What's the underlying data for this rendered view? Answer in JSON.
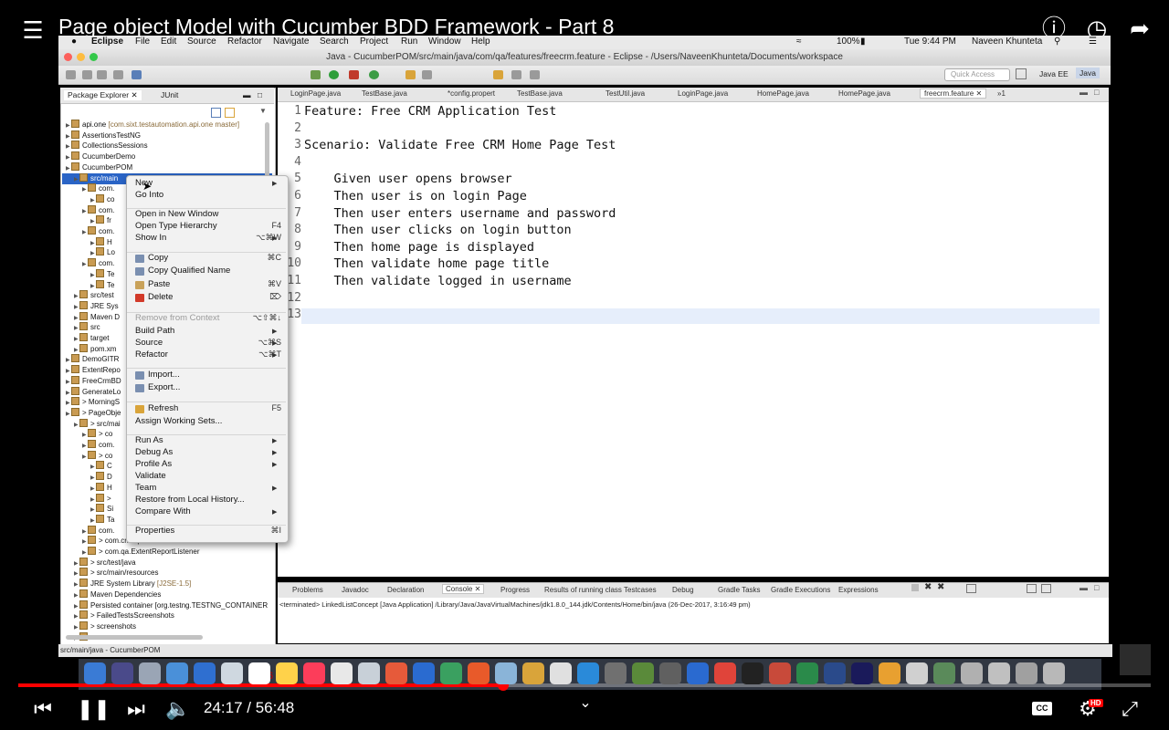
{
  "video": {
    "title": "Page object Model with Cucumber BDD Framework - Part 8",
    "time": "24:17 / 56:48",
    "progress_fraction": 0.428,
    "hd_badge": "HD"
  },
  "menubar": {
    "apple": "",
    "items": [
      "Eclipse",
      "File",
      "Edit",
      "Source",
      "Refactor",
      "Navigate",
      "Search",
      "Project",
      "Run",
      "Window",
      "Help"
    ],
    "battery": "100%",
    "clock": "Tue 9:44 PM",
    "user": "Naveen Khunteta"
  },
  "window": {
    "title": "Java - CucumberPOM/src/main/java/com/qa/features/freecrm.feature - Eclipse - /Users/NaveenKhunteta/Documents/workspace",
    "quick_access": "Quick Access",
    "perspectives": [
      "Java EE",
      "Java"
    ]
  },
  "left_panel": {
    "tabs": [
      "Package Explorer",
      "JUnit"
    ],
    "tree": [
      {
        "text": "api.one",
        "dim": " [com.sixt.testautomation.api.one master]"
      },
      {
        "text": "AssertionsTestNG",
        "dim": ""
      },
      {
        "text": "CollectionsSessions",
        "dim": ""
      },
      {
        "text": "CucumberDemo",
        "dim": ""
      },
      {
        "text": "CucumberPOM",
        "dim": ""
      },
      {
        "text": "src/main",
        "dim": ""
      },
      {
        "text": "com.",
        "dim": ""
      },
      {
        "text": "co",
        "dim": ""
      },
      {
        "text": "com.",
        "dim": ""
      },
      {
        "text": "fr",
        "dim": ""
      },
      {
        "text": "com.",
        "dim": ""
      },
      {
        "text": "H",
        "dim": ""
      },
      {
        "text": "Lo",
        "dim": ""
      },
      {
        "text": "com.",
        "dim": ""
      },
      {
        "text": "Te",
        "dim": ""
      },
      {
        "text": "Te",
        "dim": ""
      },
      {
        "text": "src/test",
        "dim": ""
      },
      {
        "text": "JRE Sys",
        "dim": ""
      },
      {
        "text": "Maven D",
        "dim": ""
      },
      {
        "text": "src",
        "dim": ""
      },
      {
        "text": "target",
        "dim": ""
      },
      {
        "text": "pom.xm",
        "dim": ""
      },
      {
        "text": "DemoGITR",
        "dim": ""
      },
      {
        "text": "ExtentRepo",
        "dim": ""
      },
      {
        "text": "FreeCrmBD",
        "dim": ""
      },
      {
        "text": "GenerateLo",
        "dim": ""
      },
      {
        "text": "> MorningS",
        "dim": ""
      },
      {
        "text": "> PageObje",
        "dim": ""
      },
      {
        "text": "> src/mai",
        "dim": ""
      },
      {
        "text": "> co",
        "dim": ""
      },
      {
        "text": "com.",
        "dim": ""
      },
      {
        "text": "> co",
        "dim": ""
      },
      {
        "text": "C",
        "dim": ""
      },
      {
        "text": "D",
        "dim": ""
      },
      {
        "text": "H",
        "dim": ""
      },
      {
        "text": ">",
        "dim": ""
      },
      {
        "text": "Si",
        "dim": ""
      },
      {
        "text": "Ta",
        "dim": ""
      },
      {
        "text": "com.",
        "dim": ""
      },
      {
        "text": "> com.crm.qa.util",
        "dim": ""
      },
      {
        "text": "> com.qa.ExtentReportListener",
        "dim": ""
      },
      {
        "text": "> src/test/java",
        "dim": ""
      },
      {
        "text": "> src/main/resources",
        "dim": ""
      },
      {
        "text": "JRE System Library",
        "dim": " [J2SE-1.5]"
      },
      {
        "text": "Maven Dependencies",
        "dim": ""
      },
      {
        "text": "Persisted container [org.testng.TESTNG_CONTAINER",
        "dim": ""
      },
      {
        "text": "> FailedTestsScreenshots",
        "dim": ""
      },
      {
        "text": "> screenshots",
        "dim": ""
      },
      {
        "text": "> src",
        "dim": ""
      }
    ]
  },
  "editor": {
    "tabs": [
      "LoginPage.java",
      "TestBase.java",
      "*config.propert",
      "TestBase.java",
      "TestUtil.java",
      "LoginPage.java",
      "HomePage.java",
      "HomePage.java",
      "freecrm.feature",
      "»1"
    ],
    "active_tab": "freecrm.feature",
    "lines": [
      {
        "n": "1",
        "text": "Feature: Free CRM Application Test"
      },
      {
        "n": "2",
        "text": ""
      },
      {
        "n": "3",
        "text": "Scenario: Validate Free CRM Home Page Test"
      },
      {
        "n": "4",
        "text": ""
      },
      {
        "n": "5",
        "text": "    Given user opens browser"
      },
      {
        "n": "6",
        "text": "    Then user is on login Page"
      },
      {
        "n": "7",
        "text": "    Then user enters username and password"
      },
      {
        "n": "8",
        "text": "    Then user clicks on login button"
      },
      {
        "n": "9",
        "text": "    Then home page is displayed"
      },
      {
        "n": "10",
        "text": "    Then validate home page title"
      },
      {
        "n": "11",
        "text": "    Then validate logged in username"
      },
      {
        "n": "12",
        "text": ""
      },
      {
        "n": "13",
        "text": ""
      }
    ]
  },
  "context_menu": {
    "items": [
      {
        "label": "New",
        "arrow": true
      },
      {
        "label": "Go Into"
      },
      {
        "label": "Open in New Window"
      },
      {
        "label": "Open Type Hierarchy",
        "shortcut": "F4"
      },
      {
        "label": "Show In",
        "shortcut": "⌥⌘W",
        "arrow": true
      },
      {
        "label": "Copy",
        "shortcut": "⌘C"
      },
      {
        "label": "Copy Qualified Name"
      },
      {
        "label": "Paste",
        "shortcut": "⌘V"
      },
      {
        "label": "Delete",
        "shortcut": "⌦"
      },
      {
        "label": "Remove from Context",
        "shortcut": "⌥⇧⌘↓",
        "disabled": true
      },
      {
        "label": "Build Path",
        "arrow": true
      },
      {
        "label": "Source",
        "shortcut": "⌥⌘S",
        "arrow": true
      },
      {
        "label": "Refactor",
        "shortcut": "⌥⌘T",
        "arrow": true
      },
      {
        "label": "Import..."
      },
      {
        "label": "Export..."
      },
      {
        "label": "Refresh",
        "shortcut": "F5"
      },
      {
        "label": "Assign Working Sets..."
      },
      {
        "label": "Run As",
        "arrow": true
      },
      {
        "label": "Debug As",
        "arrow": true
      },
      {
        "label": "Profile As",
        "arrow": true
      },
      {
        "label": "Validate"
      },
      {
        "label": "Team",
        "arrow": true
      },
      {
        "label": "Restore from Local History..."
      },
      {
        "label": "Compare With",
        "arrow": true
      },
      {
        "label": "Properties",
        "shortcut": "⌘I"
      }
    ]
  },
  "console": {
    "tabs": [
      "Problems",
      "Javadoc",
      "Declaration",
      "Console",
      "Progress",
      "Results of running class Testcases",
      "Debug",
      "Gradle Tasks",
      "Gradle Executions",
      "Expressions"
    ],
    "active_tab": "Console",
    "line": "<terminated> LinkedListConcept [Java Application] /Library/Java/JavaVirtualMachines/jdk1.8.0_144.jdk/Contents/Home/bin/java (26-Dec-2017, 3:16:49 pm)"
  },
  "statusbar": {
    "text": "src/main/java - CucumberPOM"
  },
  "dock": {
    "calendar_day": "26"
  },
  "colors": {
    "selection": "#2a64c6",
    "progress": "#ff0000",
    "current_line": "#e6eefb"
  }
}
